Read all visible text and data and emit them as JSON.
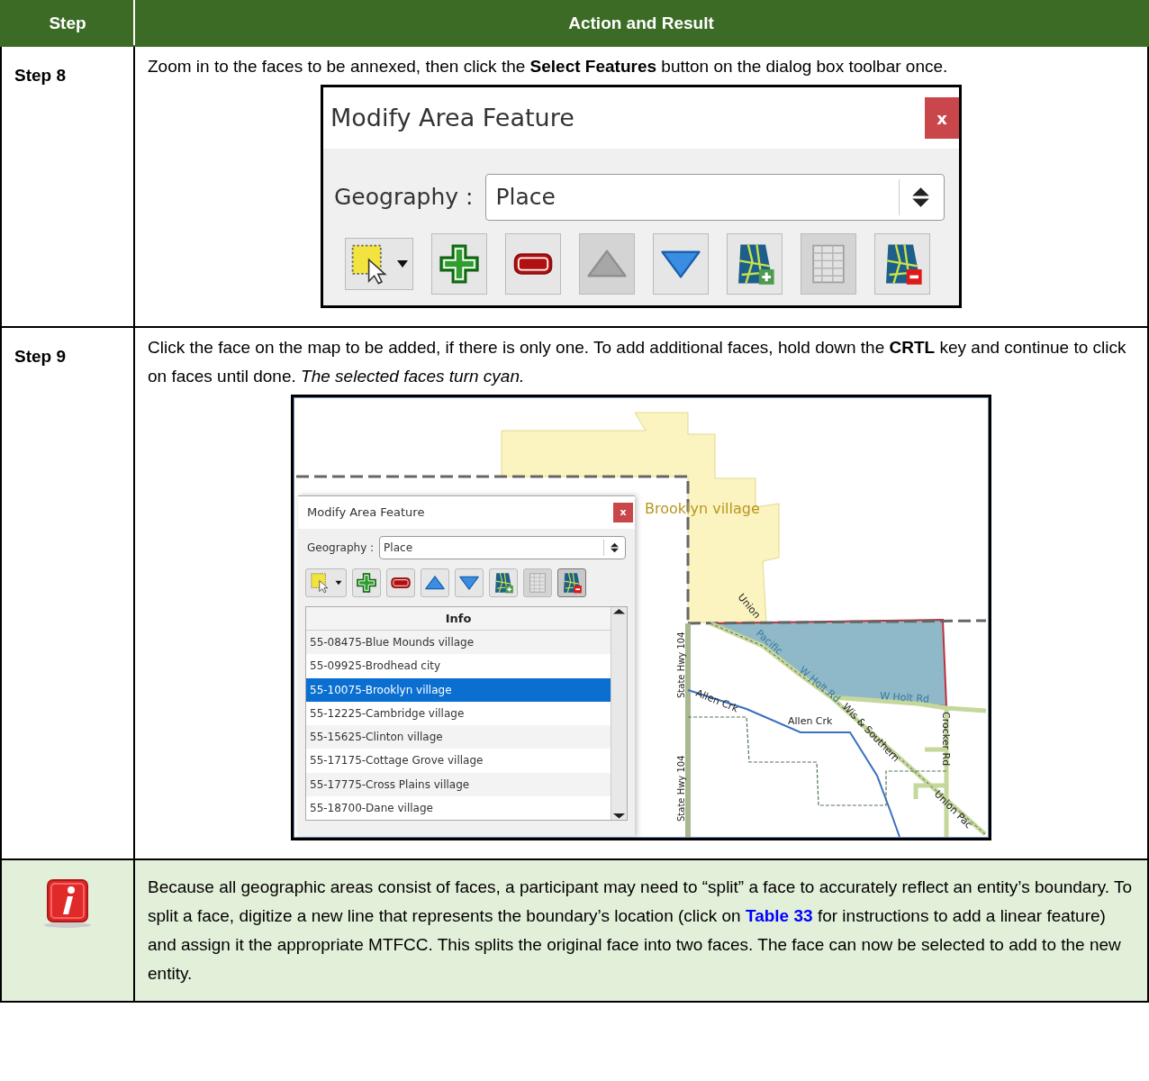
{
  "table": {
    "columns": [
      "Step",
      "Action and Result"
    ],
    "rows": [
      {
        "kind": "step",
        "step": "Step 8",
        "text": "Zoom in to the faces to be annexed, then click the **Select Features** button on the dialog box toolbar once.",
        "figure": {
          "kind": "dialog",
          "title": "Modify Area Feature",
          "close": "x",
          "geography_label": "Geography :",
          "geography_value": "Place",
          "tools": [
            {
              "kind": "select",
              "disabled": false,
              "pressed": false
            },
            {
              "kind": "add",
              "disabled": false,
              "pressed": false
            },
            {
              "kind": "remove",
              "disabled": false,
              "pressed": false
            },
            {
              "kind": "up",
              "disabled": true,
              "pressed": false
            },
            {
              "kind": "down",
              "disabled": false,
              "pressed": false
            },
            {
              "kind": "map-add",
              "disabled": false,
              "pressed": false
            },
            {
              "kind": "table",
              "disabled": true,
              "pressed": false
            },
            {
              "kind": "map-remove",
              "disabled": false,
              "pressed": false
            }
          ]
        }
      },
      {
        "kind": "step",
        "step": "Step 9",
        "text": "Click the face on the map to be added, if there is only one. To add additional faces, hold down the **CRTL** key and continue to click on faces until done. *The selected faces turn cyan.*",
        "figure": {
          "kind": "map",
          "labels": [
            {
              "kind": "place",
              "text": "Brooklyn village"
            },
            {
              "kind": "rail",
              "text": "Union"
            },
            {
              "kind": "road-selected",
              "text": "Pacific"
            },
            {
              "kind": "road-selected",
              "text": "W Holt Rd"
            },
            {
              "kind": "road-selected",
              "text": "W Holt Rd"
            },
            {
              "kind": "road",
              "text": "Allen Crk"
            },
            {
              "kind": "road",
              "text": "Allen Crk"
            },
            {
              "kind": "road",
              "text": "State Hwy 104"
            },
            {
              "kind": "road",
              "text": "State Hwy 104"
            },
            {
              "kind": "road",
              "text": "Wis & Southern"
            },
            {
              "kind": "road",
              "text": "Crocker Rd"
            },
            {
              "kind": "road",
              "text": "Union Pac"
            }
          ],
          "dialog": {
            "title": "Modify Area Feature",
            "close": "x",
            "geography_label": "Geography :",
            "geography_value": "Place",
            "tools": [
              {
                "kind": "select",
                "disabled": false,
                "pressed": false
              },
              {
                "kind": "add",
                "disabled": false,
                "pressed": false
              },
              {
                "kind": "remove",
                "disabled": false,
                "pressed": false
              },
              {
                "kind": "up",
                "disabled": false,
                "pressed": false
              },
              {
                "kind": "down",
                "disabled": false,
                "pressed": false
              },
              {
                "kind": "map-add",
                "disabled": false,
                "pressed": false
              },
              {
                "kind": "table",
                "disabled": true,
                "pressed": false
              },
              {
                "kind": "map-remove",
                "disabled": false,
                "pressed": true
              }
            ],
            "list": {
              "header": "Info",
              "items": [
                {
                  "text": "55-08475-Blue Mounds village",
                  "selected": false
                },
                {
                  "text": "55-09925-Brodhead city",
                  "selected": false
                },
                {
                  "text": "55-10075-Brooklyn village",
                  "selected": true
                },
                {
                  "text": "55-12225-Cambridge village",
                  "selected": false
                },
                {
                  "text": "55-15625-Clinton village",
                  "selected": false
                },
                {
                  "text": "55-17175-Cottage Grove village",
                  "selected": false
                },
                {
                  "text": "55-17775-Cross Plains village",
                  "selected": false
                },
                {
                  "text": "55-18700-Dane village",
                  "selected": false
                }
              ]
            }
          }
        }
      },
      {
        "kind": "note",
        "text_before": "Because all geographic areas consist of faces, a participant may need to “split” a face to accurately reflect an entity’s boundary. To split a face, digitize a new line that represents the boundary’s location (click on ",
        "link": "Table 33",
        "text_after": " for instructions to add a linear feature) and assign it the appropriate MTFCC. This splits the original face into two faces. The face can now be selected to add to the new entity."
      }
    ]
  }
}
